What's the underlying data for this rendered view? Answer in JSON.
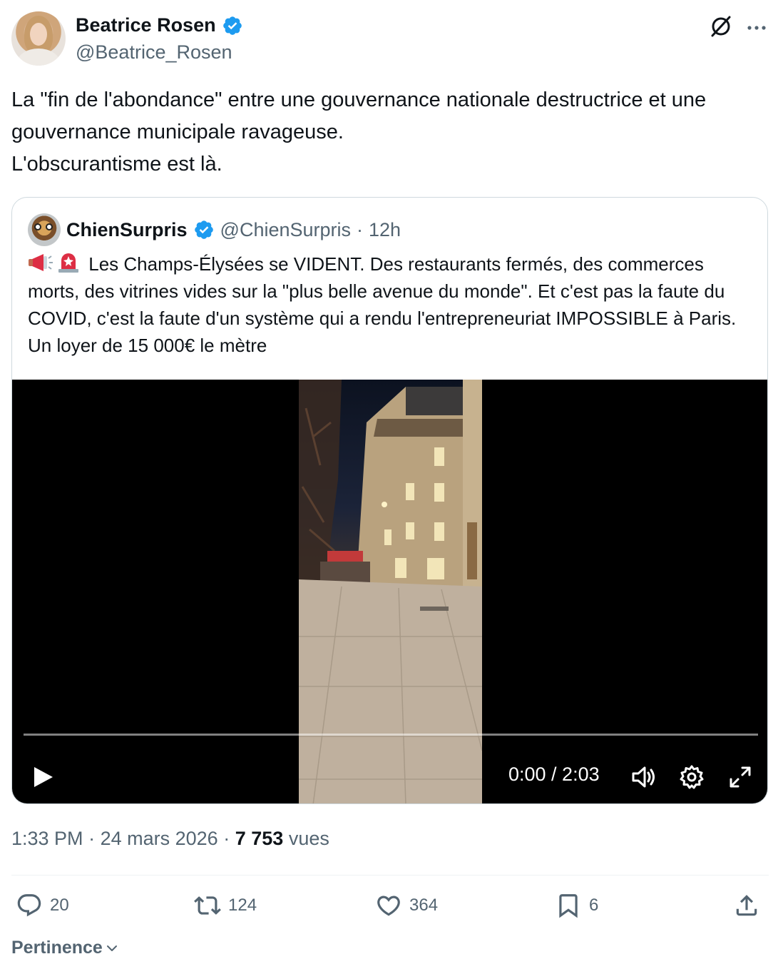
{
  "author": {
    "name": "Beatrice Rosen",
    "handle": "@Beatrice_Rosen",
    "verified": true,
    "avatar_icon": "profile-photo"
  },
  "tweet": {
    "text": "La \"fin de l'abondance\" entre une gouvernance nationale destructrice et une gouvernance municipale ravageuse.\nL'obscurantisme est là."
  },
  "quoted": {
    "name": "ChienSurpris",
    "handle": "@ChienSurpris",
    "separator": "·",
    "time": "12h",
    "emojis": [
      "megaphone-emoji",
      "police-light-emoji"
    ],
    "text": "Les Champs-Élysées se VIDENT. Des restaurants fermés, des commerces morts, des vitrines vides sur la \"plus belle avenue du monde\". Et c'est pas la faute du COVID, c'est la faute d'un système qui a rendu l'entrepreneuriat IMPOSSIBLE à Paris. Un loyer de 15 000€ le mètre",
    "video": {
      "time_display": "0:00 / 2:03",
      "progress": 0
    }
  },
  "meta": {
    "time": "1:33 PM",
    "dot": "·",
    "date": "24 mars 2026",
    "views_count": "7 753",
    "views_label": "vues"
  },
  "actions": {
    "replies": "20",
    "reposts": "124",
    "likes": "364",
    "bookmarks": "6"
  },
  "sort": {
    "label": "Pertinence"
  },
  "colors": {
    "verified_blue": "#1d9bf0",
    "text_primary": "#0f1419",
    "text_secondary": "#536471",
    "border": "#cfd9de"
  }
}
